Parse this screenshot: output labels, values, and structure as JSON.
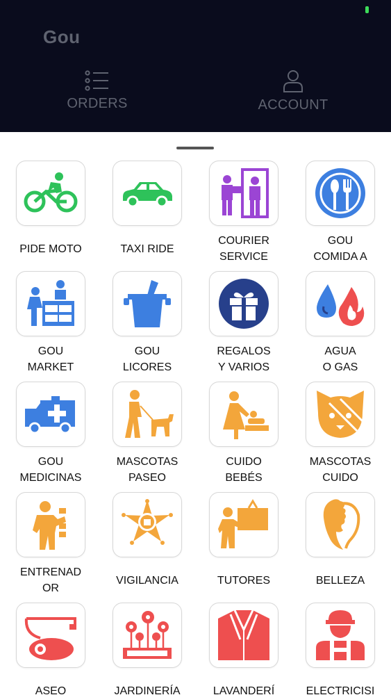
{
  "app": {
    "title": "Gou"
  },
  "nav": {
    "orders": {
      "label": "ORDERS",
      "icon": "list-icon"
    },
    "account": {
      "label": "ACCOUNT",
      "icon": "person-icon"
    }
  },
  "colors": {
    "header_bg": "#0a0c1d",
    "nav_text": "#5f6370",
    "green": "#2ec25a",
    "purple": "#9b45d4",
    "blue": "#3d7fe0",
    "navy": "#27408b",
    "orange": "#f3a63b",
    "red": "#ee4f4f"
  },
  "services": [
    {
      "label": "PIDE MOTO",
      "icon": "bicycle-icon"
    },
    {
      "label": "TAXI RIDE",
      "icon": "car-icon"
    },
    {
      "label": "COURIER\nSERVICE",
      "icon": "delivery-person-icon"
    },
    {
      "label": "GOU\nCOMIDA A",
      "icon": "plate-utensils-icon"
    },
    {
      "label": "GOU\nMARKET",
      "icon": "market-stall-icon"
    },
    {
      "label": "GOU\nLICORES",
      "icon": "ice-bucket-icon"
    },
    {
      "label": "REGALOS\nY VARIOS",
      "icon": "gift-icon"
    },
    {
      "label": "AGUA\nO GAS",
      "icon": "water-fire-icon"
    },
    {
      "label": "GOU\nMEDICINAS",
      "icon": "ambulance-icon"
    },
    {
      "label": "MASCOTAS\nPASEO",
      "icon": "dog-walk-icon"
    },
    {
      "label": "CUIDO\nBEBÉS",
      "icon": "baby-care-icon"
    },
    {
      "label": "MASCOTAS\nCUIDO",
      "icon": "cat-face-icon"
    },
    {
      "label": "ENTRENAD\nOR",
      "icon": "trainer-icon"
    },
    {
      "label": "VIGILANCIA",
      "icon": "security-badge-icon"
    },
    {
      "label": "TUTORES",
      "icon": "tutor-board-icon"
    },
    {
      "label": "BELLEZA",
      "icon": "beauty-face-icon"
    },
    {
      "label": "ASEO",
      "icon": "vacuum-icon"
    },
    {
      "label": "JARDINERÍA",
      "icon": "flowers-icon"
    },
    {
      "label": "LAVANDERÍ",
      "icon": "shirt-icon"
    },
    {
      "label": "ELECTRICISI",
      "icon": "electrician-icon"
    }
  ]
}
